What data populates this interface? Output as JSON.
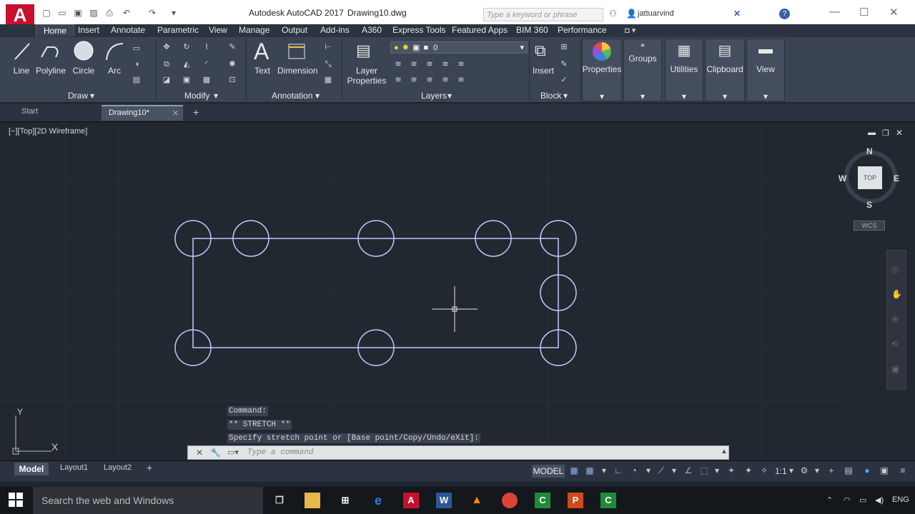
{
  "title_bar": {
    "app_title": "Autodesk AutoCAD 2017",
    "doc_title": "Drawing10.dwg",
    "search_placeholder": "Type a keyword or phrase",
    "username": "jattuarvind"
  },
  "menu_tabs": [
    "Home",
    "Insert",
    "Annotate",
    "Parametric",
    "View",
    "Manage",
    "Output",
    "Add-ins",
    "A360",
    "Express Tools",
    "Featured Apps",
    "BIM 360",
    "Performance"
  ],
  "ribbon": {
    "draw_tools": [
      "Line",
      "Polyline",
      "Circle",
      "Arc"
    ],
    "draw_panel": "Draw",
    "modify_panel": "Modify",
    "annotation_tools": [
      "Text",
      "Dimension"
    ],
    "annotation_panel": "Annotation",
    "layer_properties_label": "Layer\nProperties",
    "layer_value": "0",
    "layers_panel": "Layers",
    "insert_label": "Insert",
    "block_panel": "Block",
    "properties_label": "Properties",
    "groups_label": "Groups",
    "utilities_label": "Utilities",
    "clipboard_label": "Clipboard",
    "view_label": "View"
  },
  "file_tabs": {
    "start": "Start",
    "drawing": "Drawing10*"
  },
  "viewport": {
    "label": "[−][Top][2D Wireframe]",
    "viewcube": {
      "north": "N",
      "south": "S",
      "east": "E",
      "west": "W",
      "face": "TOP",
      "wcs": "WCS"
    },
    "ucs_x": "X",
    "ucs_y": "Y"
  },
  "command_history": [
    "Command:",
    "** STRETCH **",
    "Specify stretch point or [Base point/Copy/Undo/eXit]:"
  ],
  "command_line": {
    "placeholder": "Type a command"
  },
  "layout_tabs": [
    "Model",
    "Layout1",
    "Layout2"
  ],
  "status_bar": {
    "model_button": "MODEL",
    "scale": "1:1"
  },
  "taskbar": {
    "search_placeholder": "Search the web and Windows",
    "language": "ENG"
  },
  "colors": {
    "ribbon_bg": "#3b4453",
    "canvas_bg": "#212830",
    "geometry": "#aeb6ff",
    "autocad_red": "#c8102e"
  }
}
